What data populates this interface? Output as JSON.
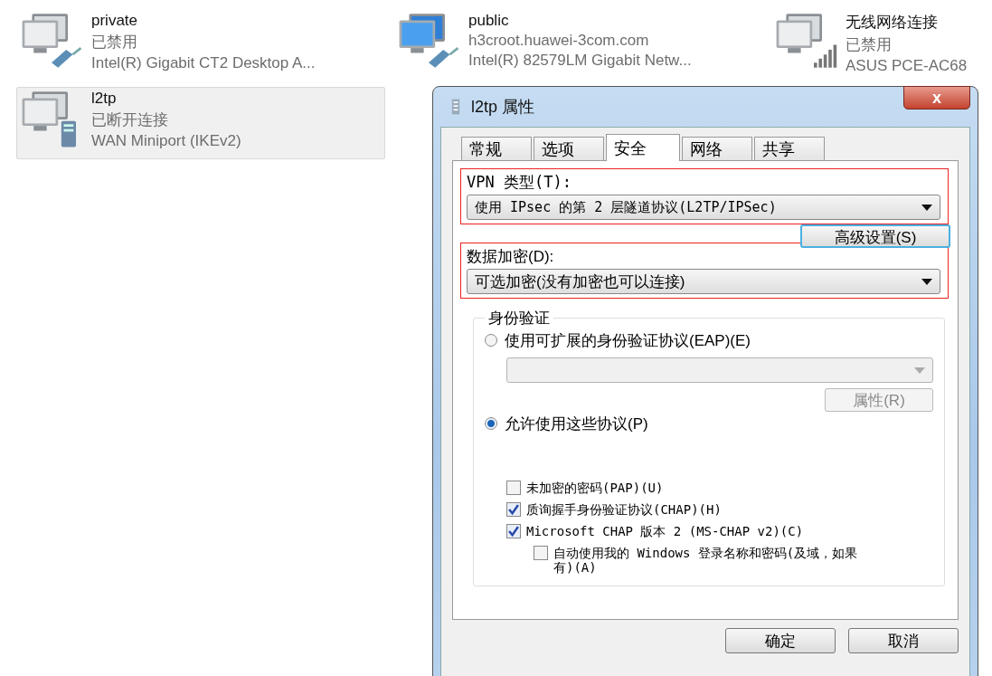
{
  "connections": [
    {
      "name": "private",
      "status": "已禁用",
      "adapter": "Intel(R) Gigabit CT2 Desktop A...",
      "kind": "wired",
      "enabled": false,
      "selected": false
    },
    {
      "name": "public",
      "status": "h3croot.huawei-3com.com",
      "adapter": "Intel(R) 82579LM Gigabit Netw...",
      "kind": "wired",
      "enabled": true,
      "selected": false
    },
    {
      "name": "无线网络连接",
      "status": "已禁用",
      "adapter": "ASUS PCE-AC68",
      "kind": "wireless",
      "enabled": false,
      "selected": false
    },
    {
      "name": "l2tp",
      "status": "已断开连接",
      "adapter": "WAN Miniport (IKEv2)",
      "kind": "wan",
      "enabled": false,
      "selected": true
    }
  ],
  "dialog": {
    "title": "l2tp 属性",
    "close": "x",
    "tabs": [
      {
        "label": "常规",
        "selected": false
      },
      {
        "label": "选项",
        "selected": false
      },
      {
        "label": "安全",
        "selected": true
      },
      {
        "label": "网络",
        "selected": false
      },
      {
        "label": "共享",
        "selected": false
      }
    ],
    "vpn_type": {
      "label": "VPN 类型(T):",
      "value": "使用 IPsec 的第 2 层隧道协议(L2TP/IPSec)",
      "highlighted": true
    },
    "advanced_button": "高级设置(S)",
    "data_encryption": {
      "label": "数据加密(D):",
      "value": "可选加密(没有加密也可以连接)",
      "highlighted": true
    },
    "authentication": {
      "title": "身份验证",
      "eap": {
        "label": "使用可扩展的身份验证协议(EAP)(E)",
        "selected": false
      },
      "eap_select": {
        "disabled": true
      },
      "properties_button": {
        "label": "属性(R)",
        "disabled": true
      },
      "allow": {
        "label": "允许使用这些协议(P)",
        "selected": true
      },
      "protocols": [
        {
          "label": "未加密的密码(PAP)(U)",
          "checked": false
        },
        {
          "label": "质询握手身份验证协议(CHAP)(H)",
          "checked": true
        },
        {
          "label": "Microsoft CHAP 版本 2 (MS-CHAP v2)(C)",
          "checked": true,
          "children": [
            {
              "label": "自动使用我的 Windows 登录名称和密码(及域，如果有)(A)",
              "checked": false
            }
          ]
        }
      ]
    },
    "buttons": [
      "确定",
      "取消"
    ]
  }
}
